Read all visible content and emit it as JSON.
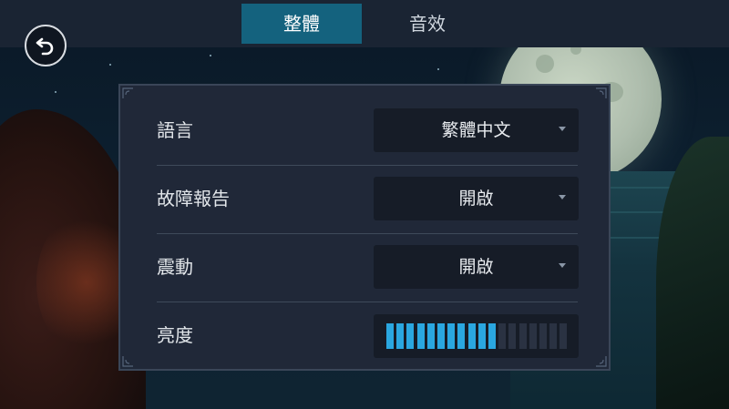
{
  "tabs": [
    {
      "label": "整體",
      "active": true
    },
    {
      "label": "音效",
      "active": false
    }
  ],
  "back_button": {
    "icon": "back-arrow-icon"
  },
  "settings": {
    "language": {
      "label": "語言",
      "value": "繁體中文"
    },
    "crash_report": {
      "label": "故障報告",
      "value": "開啟"
    },
    "vibration": {
      "label": "震動",
      "value": "開啟"
    },
    "brightness": {
      "label": "亮度",
      "level": 0.61,
      "segments_total": 18,
      "segments_on": 11
    }
  },
  "colors": {
    "active_tab": "#14627e",
    "slider_on": "#2aa7e0",
    "slider_off": "#2a3242",
    "panel_bg": "#202838"
  }
}
